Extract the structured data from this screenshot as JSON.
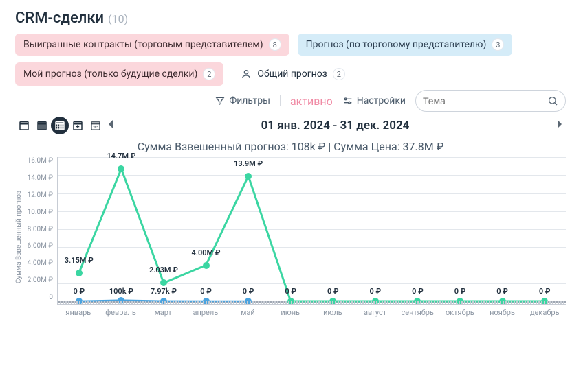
{
  "title": "CRM-сделки",
  "title_count": "(10)",
  "chips": [
    {
      "label": "Выигранные контракты (торговым представителем)",
      "badge": "8",
      "style": "pink"
    },
    {
      "label": "Прогноз (по торговому представителю)",
      "badge": "3",
      "style": "blue"
    },
    {
      "label": "Мой прогноз (только будущие сделки)",
      "badge": "2",
      "style": "pink"
    },
    {
      "label": "Общий прогноз",
      "badge": "2",
      "style": "white",
      "icon": "user"
    }
  ],
  "toolbar": {
    "filters": "Фильтры",
    "active": "активно",
    "settings": "Настройки",
    "search_placeholder": "Тема"
  },
  "range": "01 янв. 2024 - 31 дек. 2024",
  "summary": "Сумма Взвешенный прогноз: 108k ₽ | Сумма Цена: 37.8M ₽",
  "yaxis_title": "Сумма Взвешенный прогноз",
  "yticks": [
    "16.0M ₽",
    "14.0M ₽",
    "12.0M ₽",
    "10.0M ₽",
    "8.00M ₽",
    "6.00M ₽",
    "4.00M ₽",
    "2.00M ₽",
    "0"
  ],
  "chart_data": {
    "type": "line",
    "x": [
      "январь",
      "февраль",
      "март",
      "апрель",
      "май",
      "июнь",
      "июль",
      "август",
      "сентябрь",
      "октябрь",
      "ноябрь",
      "декабрь"
    ],
    "ylim": [
      0,
      16000000
    ],
    "ylabel": "Сумма Взвешенный прогноз",
    "summary": {
      "weighted_forecast": 108000,
      "price_total": 37800000,
      "currency": "₽"
    },
    "series": [
      {
        "name": "Цена",
        "color": "#3bd6a2",
        "values": [
          3150000,
          14700000,
          2030000,
          4000000,
          13900000,
          0,
          0,
          0,
          0,
          0,
          0,
          0
        ],
        "labels": [
          "3.15M ₽",
          "14.7M ₽",
          "2.03M ₽",
          "4.00M ₽",
          "13.9M ₽",
          "0 ₽",
          "0 ₽",
          "0 ₽",
          "0 ₽",
          "0 ₽",
          "0 ₽",
          "0 ₽"
        ],
        "n_labels_visible": 5
      },
      {
        "name": "Взвешенный прогноз",
        "color": "#4aa3df",
        "values": [
          0,
          100000,
          7970,
          0,
          0,
          null,
          null,
          null,
          null,
          null,
          null,
          null
        ],
        "labels": [
          "0 ₽",
          "100k ₽",
          "7.97k ₽",
          "0 ₽",
          "0 ₽",
          "",
          "",
          "",
          "",
          "",
          "",
          ""
        ],
        "n_labels_visible": 5
      }
    ]
  }
}
